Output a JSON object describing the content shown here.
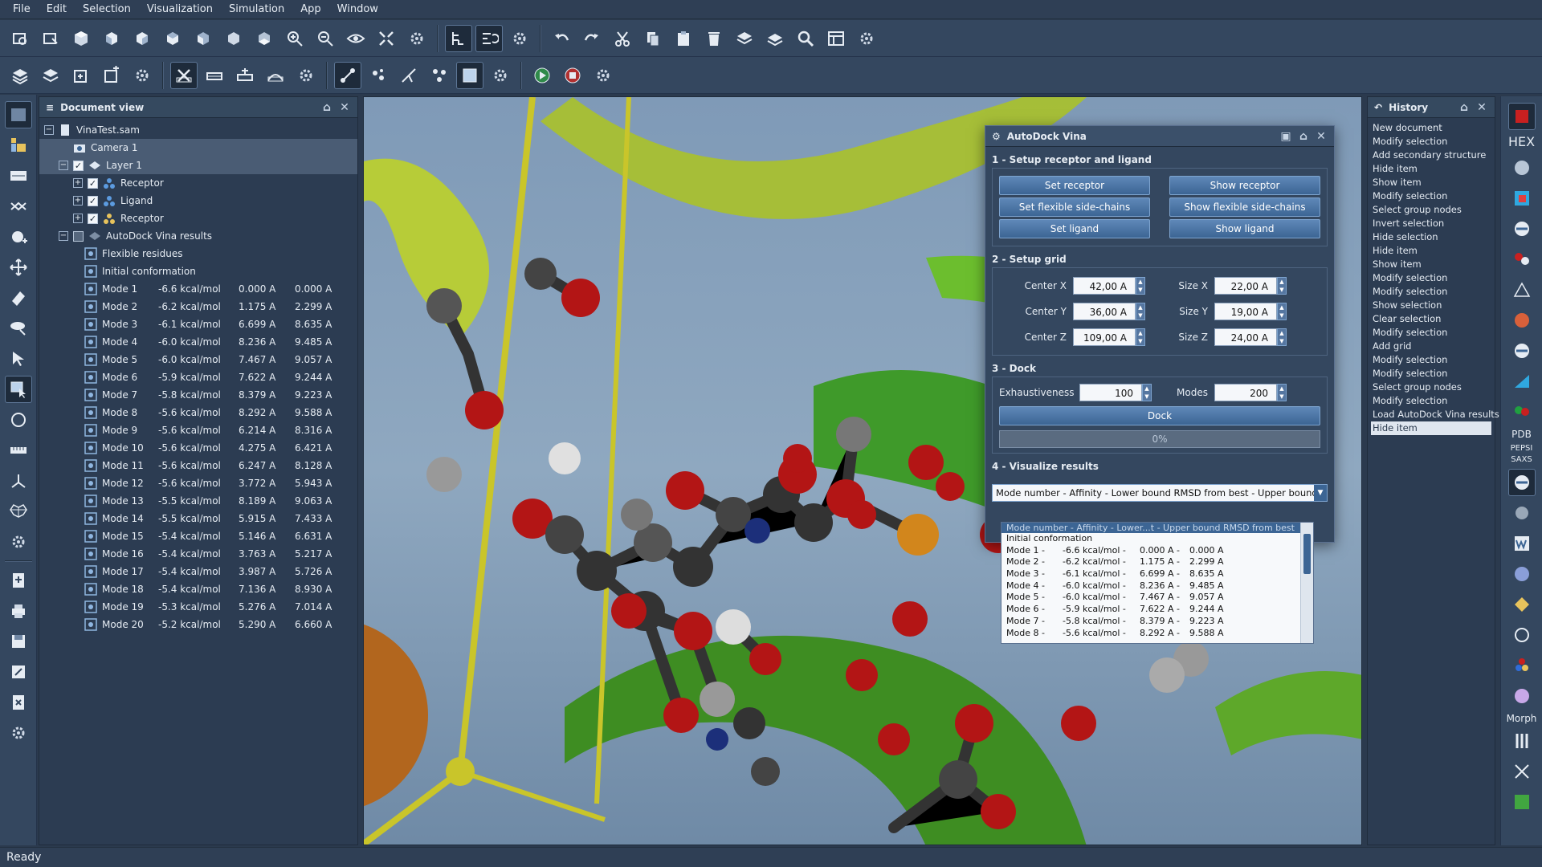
{
  "menu": [
    "File",
    "Edit",
    "Selection",
    "Visualization",
    "Simulation",
    "App",
    "Window"
  ],
  "doc_panel": {
    "title": "Document view",
    "root": "VinaTest.sam",
    "camera": "Camera 1",
    "layer": "Layer 1",
    "receptor": "Receptor",
    "ligand": "Ligand",
    "receptor2": "Receptor",
    "results": "AutoDock Vina results",
    "flexible": "Flexible residues",
    "initial": "Initial conformation",
    "modes": [
      {
        "name": "Mode 1",
        "aff": "-6.6 kcal/mol",
        "lb": "0.000 A",
        "ub": "0.000 A"
      },
      {
        "name": "Mode 2",
        "aff": "-6.2 kcal/mol",
        "lb": "1.175 A",
        "ub": "2.299 A"
      },
      {
        "name": "Mode 3",
        "aff": "-6.1 kcal/mol",
        "lb": "6.699 A",
        "ub": "8.635 A"
      },
      {
        "name": "Mode 4",
        "aff": "-6.0 kcal/mol",
        "lb": "8.236 A",
        "ub": "9.485 A"
      },
      {
        "name": "Mode 5",
        "aff": "-6.0 kcal/mol",
        "lb": "7.467 A",
        "ub": "9.057 A"
      },
      {
        "name": "Mode 6",
        "aff": "-5.9 kcal/mol",
        "lb": "7.622 A",
        "ub": "9.244 A"
      },
      {
        "name": "Mode 7",
        "aff": "-5.8 kcal/mol",
        "lb": "8.379 A",
        "ub": "9.223 A"
      },
      {
        "name": "Mode 8",
        "aff": "-5.6 kcal/mol",
        "lb": "8.292 A",
        "ub": "9.588 A"
      },
      {
        "name": "Mode 9",
        "aff": "-5.6 kcal/mol",
        "lb": "6.214 A",
        "ub": "8.316 A"
      },
      {
        "name": "Mode 10",
        "aff": "-5.6 kcal/mol",
        "lb": "4.275 A",
        "ub": "6.421 A"
      },
      {
        "name": "Mode 11",
        "aff": "-5.6 kcal/mol",
        "lb": "6.247 A",
        "ub": "8.128 A"
      },
      {
        "name": "Mode 12",
        "aff": "-5.6 kcal/mol",
        "lb": "3.772 A",
        "ub": "5.943 A"
      },
      {
        "name": "Mode 13",
        "aff": "-5.5 kcal/mol",
        "lb": "8.189 A",
        "ub": "9.063 A"
      },
      {
        "name": "Mode 14",
        "aff": "-5.5 kcal/mol",
        "lb": "5.915 A",
        "ub": "7.433 A"
      },
      {
        "name": "Mode 15",
        "aff": "-5.4 kcal/mol",
        "lb": "5.146 A",
        "ub": "6.631 A"
      },
      {
        "name": "Mode 16",
        "aff": "-5.4 kcal/mol",
        "lb": "3.763 A",
        "ub": "5.217 A"
      },
      {
        "name": "Mode 17",
        "aff": "-5.4 kcal/mol",
        "lb": "3.987 A",
        "ub": "5.726 A"
      },
      {
        "name": "Mode 18",
        "aff": "-5.4 kcal/mol",
        "lb": "7.136 A",
        "ub": "8.930 A"
      },
      {
        "name": "Mode 19",
        "aff": "-5.3 kcal/mol",
        "lb": "5.276 A",
        "ub": "7.014 A"
      },
      {
        "name": "Mode 20",
        "aff": "-5.2 kcal/mol",
        "lb": "5.290 A",
        "ub": "6.660 A"
      }
    ]
  },
  "dock": {
    "title": "AutoDock Vina",
    "s1": "1 - Setup receptor and ligand",
    "set_receptor": "Set receptor",
    "show_receptor": "Show receptor",
    "set_flex": "Set flexible side-chains",
    "show_flex": "Show flexible side-chains",
    "set_ligand": "Set ligand",
    "show_ligand": "Show ligand",
    "s2": "2 - Setup grid",
    "center_x_label": "Center X",
    "center_x": "42,00 A",
    "size_x_label": "Size X",
    "size_x": "22,00 A",
    "center_y_label": "Center Y",
    "center_y": "36,00 A",
    "size_y_label": "Size Y",
    "size_y": "19,00 A",
    "center_z_label": "Center Z",
    "center_z": "109,00 A",
    "size_z_label": "Size Z",
    "size_z": "24,00 A",
    "s3": "3 - Dock",
    "exh_label": "Exhaustiveness",
    "exh": "100",
    "modes_label": "Modes",
    "modes": "200",
    "dock_btn": "Dock",
    "progress": "0%",
    "s4": "4 - Visualize results",
    "combo": "Mode number - Affinity - Lower bound RMSD from best - Upper bound RMSD from best"
  },
  "droplist": {
    "head": "Mode number - Affinity - Lower...t - Upper bound RMSD from best",
    "initial": "Initial conformation",
    "rows": [
      {
        "n": "Mode    1 -",
        "a": "-6.6 kcal/mol -",
        "l": "0.000 A -",
        "u": "0.000 A"
      },
      {
        "n": "Mode    2 -",
        "a": "-6.2 kcal/mol -",
        "l": "1.175 A -",
        "u": "2.299 A"
      },
      {
        "n": "Mode    3 -",
        "a": "-6.1 kcal/mol -",
        "l": "6.699 A -",
        "u": "8.635 A"
      },
      {
        "n": "Mode    4 -",
        "a": "-6.0 kcal/mol -",
        "l": "8.236 A -",
        "u": "9.485 A"
      },
      {
        "n": "Mode    5 -",
        "a": "-6.0 kcal/mol -",
        "l": "7.467 A -",
        "u": "9.057 A"
      },
      {
        "n": "Mode    6 -",
        "a": "-5.9 kcal/mol -",
        "l": "7.622 A -",
        "u": "9.244 A"
      },
      {
        "n": "Mode    7 -",
        "a": "-5.8 kcal/mol -",
        "l": "8.379 A -",
        "u": "9.223 A"
      },
      {
        "n": "Mode    8 -",
        "a": "-5.6 kcal/mol -",
        "l": "8.292 A -",
        "u": "9.588 A"
      }
    ]
  },
  "history": {
    "title": "History",
    "items": [
      "New document",
      "Modify selection",
      "Add secondary structure",
      "Hide item",
      "Show item",
      "Modify selection",
      "Select group nodes",
      "Invert selection",
      "Hide selection",
      "Hide item",
      "Show item",
      "Modify selection",
      "Modify selection",
      "Show selection",
      "Clear selection",
      "Modify selection",
      "Add grid",
      "Modify selection",
      "Modify selection",
      "Select group nodes",
      "Modify selection",
      "Load AutoDock Vina results",
      "Hide item"
    ]
  },
  "right_labels": {
    "hex": "HEX",
    "pdb": "PDB",
    "pepsi": "PEPSI SAXS",
    "morph": "Morph"
  },
  "status": "Ready",
  "colors": {
    "accent": "#3c6594",
    "panel": "#2c3c52",
    "viewport": "#8fa8c0"
  }
}
